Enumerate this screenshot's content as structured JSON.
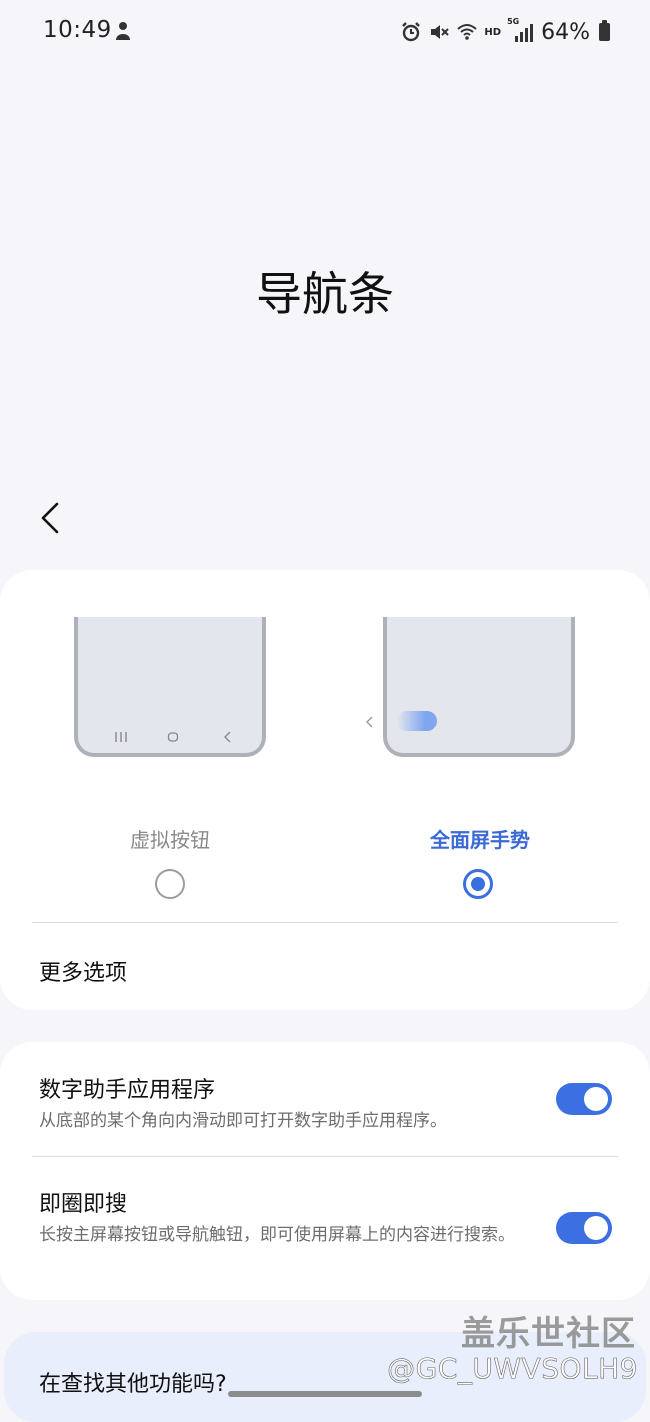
{
  "status_bar": {
    "time": "10:49",
    "network": "HD",
    "network_gen": "5G",
    "battery_percent": "64%"
  },
  "page": {
    "title": "导航条"
  },
  "navigation_type": {
    "options": [
      {
        "label": "虚拟按钮",
        "selected": false
      },
      {
        "label": "全面屏手势",
        "selected": true
      }
    ],
    "more_options_label": "更多选项"
  },
  "settings": {
    "digital_assistant": {
      "title": "数字助手应用程序",
      "subtitle": "从底部的某个角向内滑动即可打开数字助手应用程序。",
      "enabled": true
    },
    "circle_to_search": {
      "title": "即圈即搜",
      "subtitle": "长按主屏幕按钮或导航触钮，即可使用屏幕上的内容进行搜索。",
      "enabled": true
    }
  },
  "footer_card": {
    "title": "在查找其他功能吗?"
  },
  "watermark": {
    "brand": "盖乐世社区",
    "user": "@GC_UWVSOLH9"
  },
  "colors": {
    "accent": "#3b6fe2",
    "background": "#f6f6fa",
    "card": "#ffffff"
  }
}
